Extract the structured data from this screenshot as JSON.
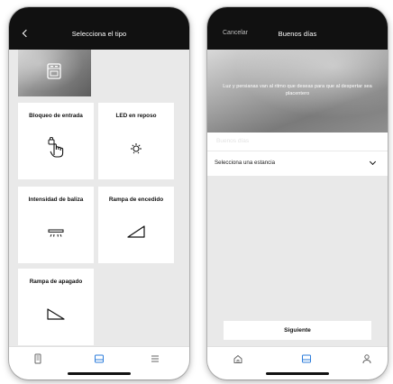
{
  "left_screen": {
    "header": {
      "title": "Selecciona el tipo"
    },
    "tiles": [
      {
        "label": "Bloqueo de entrada",
        "icon": "hand-lock-icon"
      },
      {
        "label": "LED en reposo",
        "icon": "led-sun-icon"
      },
      {
        "label": "Intensidad de baliza",
        "icon": "beacon-icon"
      },
      {
        "label": "Rampa de encedido",
        "icon": "ramp-up-icon"
      },
      {
        "label": "Rampa de apagado",
        "icon": "ramp-down-icon"
      }
    ],
    "hero_icon": "appliance-icon",
    "bottom_nav": [
      "device-icon",
      "scenes-icon",
      "menu-icon"
    ],
    "active_nav_color": "#2d7ddb"
  },
  "right_screen": {
    "header": {
      "cancel_label": "Cancelar",
      "title": "Buenos días"
    },
    "description": "Luz y persianas van al ritmo que deseas para que al despertar sea placentero",
    "name_placeholder": "Buenos días",
    "room_select": {
      "selected": "Selecciona una estancia"
    },
    "next_button": "Siguiente",
    "bottom_nav": [
      "home-icon",
      "scenes-icon",
      "user-icon"
    ]
  }
}
